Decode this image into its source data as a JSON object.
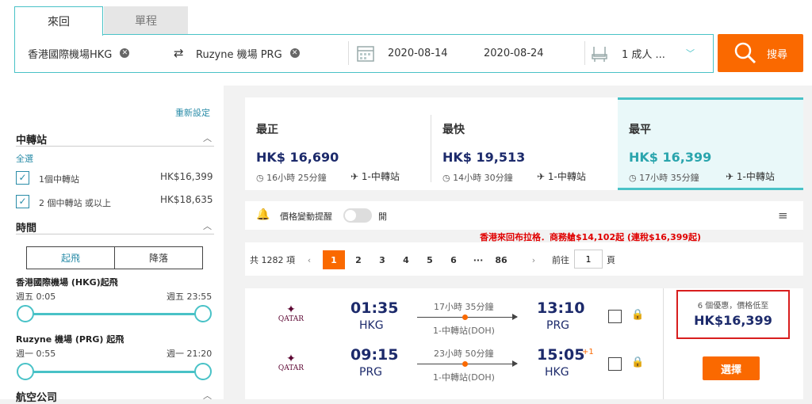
{
  "tabs": {
    "roundtrip": "來回",
    "oneway": "單程"
  },
  "search": {
    "origin": "香港國際機場HKG",
    "destination": "Ruzyne 機場 PRG",
    "depart_date": "2020-08-14",
    "return_date": "2020-08-24",
    "travellers": "1 成人 ...",
    "button": "搜尋"
  },
  "sidebar": {
    "reset": "重新設定",
    "stops": {
      "title": "中轉站",
      "select_all": "全選",
      "options": [
        {
          "label": "1個中轉站",
          "price": "HK$16,399"
        },
        {
          "label": "2 個中轉站 或以上",
          "price": "HK$18,635"
        }
      ]
    },
    "time": {
      "title": "時間",
      "tabs": [
        "起飛",
        "降落"
      ],
      "slider1": {
        "label": "香港國際機場 (HKG)起飛",
        "from": "週五 0:05",
        "to": "週五 23:55"
      },
      "slider2": {
        "label": "Ruzyne 機場 (PRG) 起飛",
        "from": "週一 0:55",
        "to": "週一 21:20"
      }
    },
    "airlines": {
      "title": "航空公司"
    }
  },
  "summary": [
    {
      "label": "最正",
      "price": "HK$ 16,690",
      "duration": "16小時 25分鐘",
      "stops": "1-中轉站"
    },
    {
      "label": "最快",
      "price": "HK$ 19,513",
      "duration": "14小時 30分鐘",
      "stops": "1-中轉站"
    },
    {
      "label": "最平",
      "price": "HK$ 16,399",
      "duration": "17小時 35分鐘",
      "stops": "1-中轉站"
    }
  ],
  "alert": {
    "label": "價格變動提醒",
    "state": "開"
  },
  "promo": "香港來回布拉格．商務艙$14,102起 (連稅$16,399起)",
  "pager": {
    "total": "共 1282 項",
    "pages": [
      "1",
      "2",
      "3",
      "4",
      "5",
      "6",
      "···",
      "86"
    ],
    "goto_label": "前往",
    "goto_value": "1",
    "page_suffix": "頁"
  },
  "result": {
    "outbound": {
      "airline": "QATAR",
      "dep_time": "01:35",
      "dep_code": "HKG",
      "duration": "17小時 35分鐘",
      "stops": "1-中轉站(DOH)",
      "arr_time": "13:10",
      "arr_code": "PRG"
    },
    "inbound": {
      "airline": "QATAR",
      "dep_time": "09:15",
      "dep_code": "PRG",
      "duration": "23小時 50分鐘",
      "stops": "1-中轉站(DOH)",
      "arr_time": "15:05",
      "arr_plus": "+1",
      "arr_code": "HKG"
    },
    "deals": "6 個優惠，價格低至",
    "price": "HK$16,399",
    "select": "選擇"
  },
  "colors": {
    "accent": "#49c2c7",
    "orange": "#fa6900",
    "navy": "#1c2a6b",
    "promo": "#e00000"
  }
}
